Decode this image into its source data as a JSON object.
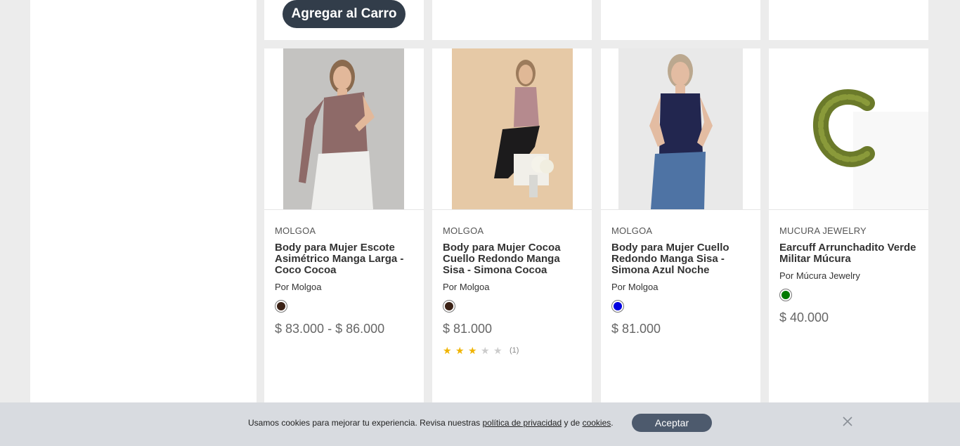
{
  "top_row": {
    "cart_label": "Agregar al Carro"
  },
  "products": [
    {
      "brand": "MOLGOA",
      "title": "Body para Mujer Escote Asimétrico Manga Larga - Coco Cocoa",
      "seller": "Por Molgoa",
      "swatch_color": "#3b2216",
      "price": "$ 83.000 - $ 86.000"
    },
    {
      "brand": "MOLGOA",
      "title": "Body para Mujer Cocoa Cuello Redondo Manga Sisa - Simona Cocoa",
      "seller": "Por Molgoa",
      "swatch_color": "#3b2216",
      "price": "$ 81.000",
      "rating": 3,
      "rating_max": 5,
      "review_count": "(1)"
    },
    {
      "brand": "MOLGOA",
      "title": "Body para Mujer Cuello Redondo Manga Sisa - Simona Azul Noche",
      "seller": "Por Molgoa",
      "swatch_color": "#0000e0",
      "price": "$ 81.000"
    },
    {
      "brand": "MUCURA JEWELRY",
      "title": "Earcuff Arrunchadito Verde Militar Múcura",
      "seller": "Por Múcura Jewelry",
      "swatch_color": "#007a00",
      "price": "$ 40.000"
    }
  ],
  "cookie": {
    "text_before": "Usamos cookies para mejorar tu experiencia. Revisa nuestras ",
    "privacy_link": "política de privacidad",
    "text_middle": " y de ",
    "cookies_link": "cookies",
    "text_after": ".",
    "accept_label": "Aceptar"
  },
  "icons": {
    "close": "close-icon",
    "star": "star-icon"
  }
}
